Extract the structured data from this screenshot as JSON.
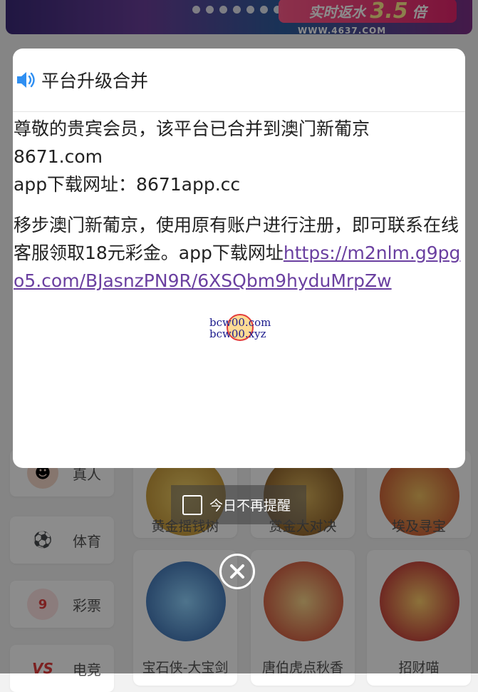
{
  "banner": {
    "promo_text": "实时返水",
    "promo_value": "3.5",
    "promo_unit": "倍",
    "url_text": "WWW.4637.COM"
  },
  "sidebar": {
    "items": [
      {
        "label": "真人",
        "icon": "live-dealer-icon"
      },
      {
        "label": "体育",
        "icon": "soccer-ball-icon"
      },
      {
        "label": "彩票",
        "icon": "lottery-ball-icon"
      },
      {
        "label": "电竞",
        "icon": "vs-esports-icon"
      }
    ]
  },
  "games": [
    {
      "name": "黄金摇钱树"
    },
    {
      "name": "赏金大对决"
    },
    {
      "name": "埃及寻宝"
    },
    {
      "name": "宝石侠-大宝剑"
    },
    {
      "name": "唐伯虎点秋香"
    },
    {
      "name": "招财喵"
    }
  ],
  "modal": {
    "title": "平台升级合并",
    "line1": "尊敬的贵宾会员，该平台已合并到澳门新葡京",
    "line2": "8671.com",
    "line3": "app下载网址：8671app.cc",
    "paragraph2": "移步澳门新葡京，使用原有账户进行注册，即可联系在线客服领取18元彩金。app下载网址",
    "link": "https://m2nlm.g9pgo5.com/BJasnzPN9R/6XSQbm9hyduMrpZw",
    "watermark_line1": "bcw00.com",
    "watermark_line2": "bcw00.xyz"
  },
  "dont_show_today": "今日不再提醒",
  "colors": {
    "link": "#6a3fa0",
    "speaker": "#2f8ff2"
  }
}
